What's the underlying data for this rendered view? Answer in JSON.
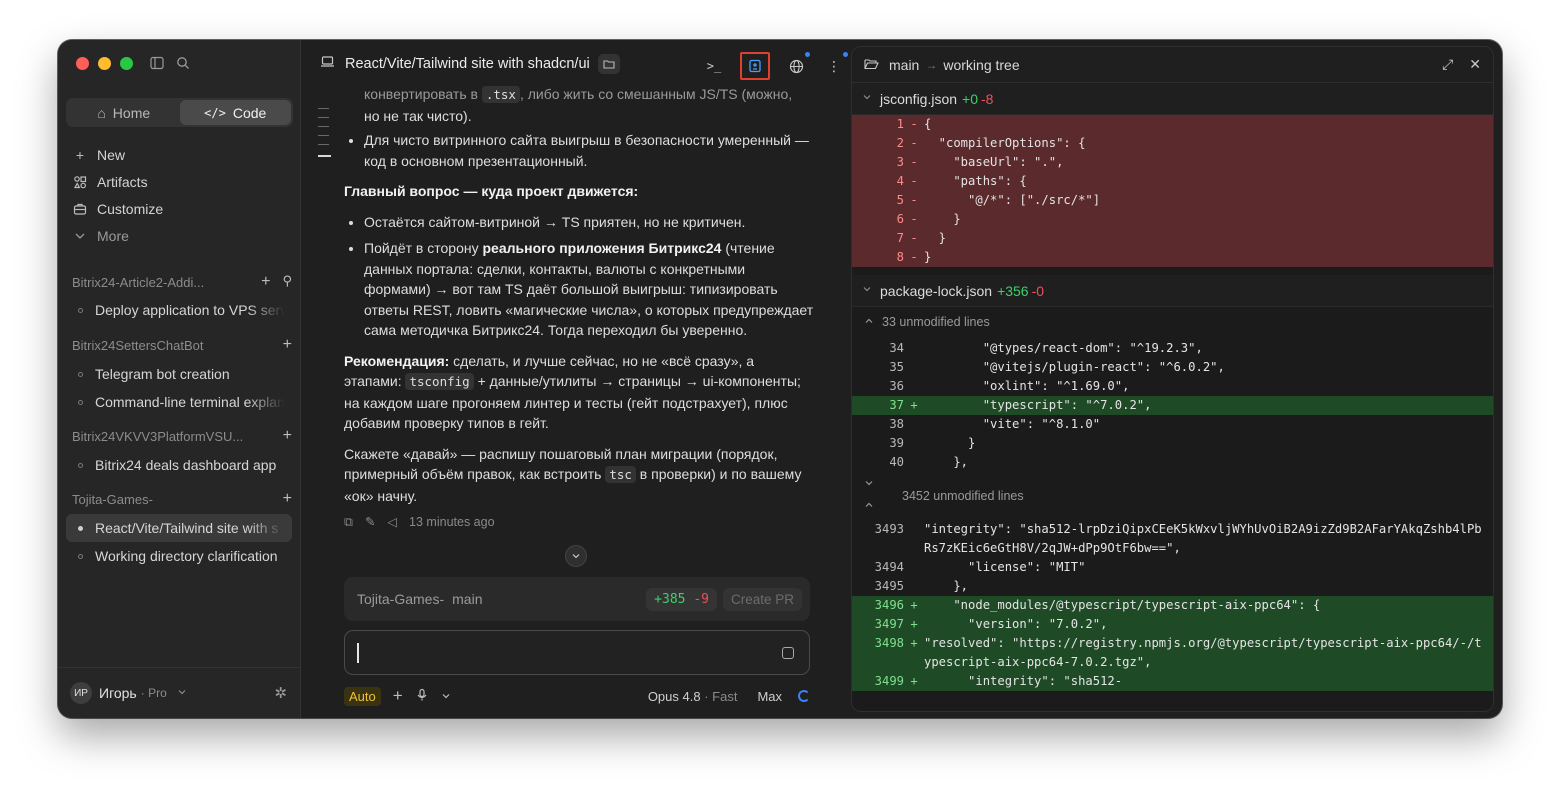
{
  "sidebar": {
    "tabs": {
      "home": "Home",
      "code": "Code"
    },
    "nav": [
      {
        "icon": "plus-icon",
        "label": "New"
      },
      {
        "icon": "artifacts-icon",
        "label": "Artifacts"
      },
      {
        "icon": "briefcase-icon",
        "label": "Customize"
      },
      {
        "icon": "chevron-down-icon",
        "label": "More"
      }
    ],
    "sections": [
      {
        "title": "Bitrix24-Article2-Addi...",
        "items": [
          "Deploy application to VPS serv"
        ]
      },
      {
        "title": "Bitrix24SettersChatBot",
        "items": [
          "Telegram bot creation",
          "Command-line terminal explan"
        ]
      },
      {
        "title": "Bitrix24VKVV3PlatformVSU...",
        "items": [
          "Bitrix24 deals dashboard app"
        ]
      },
      {
        "title": "Tojita-Games-",
        "items": [
          "React/Vite/Tailwind site with s",
          "Working directory clarification"
        ]
      }
    ],
    "user": {
      "initials": "ИР",
      "name": "Игорь",
      "plan": "· Pro"
    }
  },
  "chat": {
    "title": "React/Vite/Tailwind site with shadcn/ui",
    "message": {
      "top_line_1a": "конвертировать в",
      "top_code": ".tsx",
      "top_line_1b": ", либо жить со смешанным JS/TS (можно,",
      "top_line_2": "но не так чисто).",
      "bullet_safety": "Для чисто витринного сайта выигрыш в безопасности умеренный — код в основном презентационный.",
      "question_heading": "Главный вопрос — куда проект движется:",
      "bullet_a": "Остаётся сайтом-витриной → TS приятен, но не критичен.",
      "bullet_b_pre": "Пойдёт в сторону ",
      "bullet_b_bold": "реального приложения Битрикс24",
      "bullet_b_post": " (чтение данных портала: сделки, контакты, валюты с конкретными формами) → вот там TS даёт большой выигрыш: типизировать ответы REST, ловить «магические числа», о которых предупреждает сама методичка Битрикс24. Тогда переходил бы уверенно.",
      "rec_bold": "Рекомендация:",
      "rec_1": " сделать, и лучше сейчас, но не «всё сразу», а этапами: ",
      "rec_code": "tsconfig",
      "rec_2": " + данные/утилиты → страницы → ui-компоненты; на каждом шаге прогоняем линтер и тесты (гейт подстрахует), плюс добавим проверку типов в гейт.",
      "final_1": "Скажете «давай» — распишу пошаговый план миграции (порядок, примерный объём правок, как встроить ",
      "final_code": "tsc",
      "final_2": " в проверки) и по вашему «ок» начну.",
      "timestamp": "13 minutes ago"
    },
    "branch_bar": {
      "repo": "Tojita-Games-",
      "branch": "main",
      "added": "+385",
      "removed": "-9",
      "create_pr": "Create PR"
    },
    "composer": {
      "mode": "Auto",
      "model": "Opus 4.8",
      "speed": "· Fast",
      "effort": "Max"
    }
  },
  "diff": {
    "branch": "main",
    "target": "working tree",
    "files": [
      {
        "name": "jsconfig.json",
        "added": "+0",
        "removed": "-8",
        "lines": [
          {
            "n": "1",
            "t": "{"
          },
          {
            "n": "2",
            "t": "  \"compilerOptions\": {"
          },
          {
            "n": "3",
            "t": "    \"baseUrl\": \".\","
          },
          {
            "n": "4",
            "t": "    \"paths\": {"
          },
          {
            "n": "5",
            "t": "      \"@/*\": [\"./src/*\"]"
          },
          {
            "n": "6",
            "t": "    }"
          },
          {
            "n": "7",
            "t": "  }"
          },
          {
            "n": "8",
            "t": "}"
          }
        ]
      },
      {
        "name": "package-lock.json",
        "added": "+356",
        "removed": "-0",
        "unmodified_top": "33 unmodified lines",
        "lines_a": [
          {
            "n": "34",
            "t": "        \"@types/react-dom\": \"^19.2.3\",",
            "k": ""
          },
          {
            "n": "35",
            "t": "        \"@vitejs/plugin-react\": \"^6.0.2\",",
            "k": ""
          },
          {
            "n": "36",
            "t": "        \"oxlint\": \"^1.69.0\",",
            "k": ""
          },
          {
            "n": "37",
            "t": "        \"typescript\": \"^7.0.2\",",
            "k": "add"
          },
          {
            "n": "38",
            "t": "        \"vite\": \"^8.1.0\"",
            "k": ""
          },
          {
            "n": "39",
            "t": "      }",
            "k": ""
          },
          {
            "n": "40",
            "t": "    },",
            "k": ""
          }
        ],
        "unmodified_mid": "3452 unmodified lines",
        "lines_b": [
          {
            "n": "3493",
            "t": "      \"integrity\": \"sha512-lrpDziQipxCEeK5kWxvljWYhUvOiB2A9izZd9B2AFarYAkqZshb4lPbRs7zKEic6eGtH8V/2qJW+dPp9OtF6bw==\",",
            "k": ""
          },
          {
            "n": "3494",
            "t": "      \"license\": \"MIT\"",
            "k": ""
          },
          {
            "n": "3495",
            "t": "    },",
            "k": ""
          },
          {
            "n": "3496",
            "t": "    \"node_modules/@typescript/typescript-aix-ppc64\": {",
            "k": "add"
          },
          {
            "n": "3497",
            "t": "      \"version\": \"7.0.2\",",
            "k": "add"
          },
          {
            "n": "3498",
            "t": "      \"resolved\": \"https://registry.npmjs.org/@typescript/typescript-aix-ppc64/-/typescript-aix-ppc64-7.0.2.tgz\",",
            "k": "add"
          },
          {
            "n": "3499",
            "t": "      \"integrity\": \"sha512-",
            "k": "add"
          }
        ]
      }
    ]
  },
  "colors": {
    "accent_blue": "#4a9eff",
    "highlight_box": "#e0402f",
    "added": "#3fcf6a",
    "removed": "#f0505a"
  }
}
